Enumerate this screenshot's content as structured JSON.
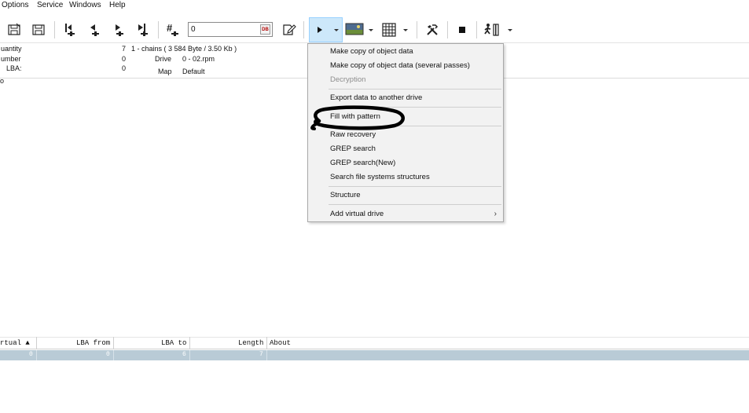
{
  "menubar": {
    "options": "Options",
    "service": "Service",
    "windows": "Windows",
    "help": "Help"
  },
  "toolbar": {
    "lba_value": "0",
    "lba_db_badge": "DB",
    "icons": [
      "save-disk-icon",
      "save-disk-alt-icon",
      "first-sector-icon",
      "prev-sector-icon",
      "next-sector-icon",
      "last-sector-icon",
      "goto-sector-icon",
      "edit-form-icon",
      "play-icon",
      "dropdown-arrow-icon",
      "image-preview-icon",
      "grid-view-icon",
      "tools-icon",
      "stop-icon",
      "run-exit-icon"
    ]
  },
  "info": {
    "quantity_label": "uantity",
    "quantity_value": "7",
    "chains_text": "1 - chains (  3 584 Byte / 3.50 Kb )",
    "number_label": "umber",
    "number_value": "0",
    "drive_label": "Drive",
    "drive_value": "0 - 02.rpm",
    "lba_label": "LBA:",
    "lba_value": "0",
    "map_label": "Map",
    "map_value": "Default",
    "partial_char": "o"
  },
  "dropdown": {
    "items": [
      {
        "label": "Make copy of object data",
        "disabled": false
      },
      {
        "label": "Make copy of object data (several passes)",
        "disabled": false
      },
      {
        "label": "Decryption",
        "disabled": true
      },
      {
        "label": "Export data to another drive",
        "disabled": false
      },
      {
        "label": "Fill with pattern",
        "disabled": false
      },
      {
        "label": "Raw recovery",
        "disabled": false
      },
      {
        "label": "GREP search",
        "disabled": false
      },
      {
        "label": "GREP search(New)",
        "disabled": false
      },
      {
        "label": "Search file systems structures",
        "disabled": false
      },
      {
        "label": "Structure",
        "disabled": false
      },
      {
        "label": "Add virtual drive",
        "disabled": false
      }
    ],
    "submenu_arrow": "›"
  },
  "table": {
    "headers": [
      "rtual ▲",
      "LBA from",
      "LBA to",
      "Length",
      "About"
    ],
    "rows": [
      [
        "0",
        "0",
        "6",
        "7",
        ""
      ]
    ]
  },
  "colors": {
    "active_button_bg": "#cde8fa",
    "selected_row_bg": "#b9cbd6",
    "menu_bg": "#f2f2f2",
    "annotation_stroke": "#000000"
  }
}
